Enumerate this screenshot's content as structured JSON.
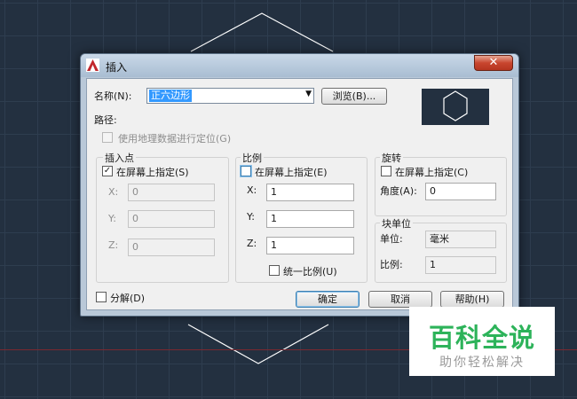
{
  "dialog": {
    "title": "插入",
    "close_glyph": "✕",
    "name_label": "名称(N):",
    "name_value": "正六边形",
    "browse_label": "浏览(B)...",
    "path_label": "路径:",
    "geo_label": "使用地理数据进行定位(G)",
    "insertion": {
      "title": "插入点",
      "specify_label": "在屏幕上指定(S)",
      "specify_checked": true,
      "x_label": "X:",
      "x_value": "0",
      "y_label": "Y:",
      "y_value": "0",
      "z_label": "Z:",
      "z_value": "0"
    },
    "scale": {
      "title": "比例",
      "specify_label": "在屏幕上指定(E)",
      "specify_checked": false,
      "x_label": "X:",
      "x_value": "1",
      "y_label": "Y:",
      "y_value": "1",
      "z_label": "Z:",
      "z_value": "1",
      "uniform_label": "统一比例(U)"
    },
    "rotation": {
      "title": "旋转",
      "specify_label": "在屏幕上指定(C)",
      "specify_checked": false,
      "angle_label": "角度(A):",
      "angle_value": "0"
    },
    "block_unit": {
      "title": "块单位",
      "unit_label": "单位:",
      "unit_value": "毫米",
      "factor_label": "比例:",
      "factor_value": "1"
    },
    "explode_label": "分解(D)",
    "ok_label": "确定",
    "cancel_label": "取消",
    "help_label": "帮助(H)"
  },
  "watermark": {
    "main": "百科全说",
    "sub": "助你轻松解决"
  },
  "colors": {
    "canvas_bg": "#233040",
    "selection": "#3399ff",
    "watermark_green": "#2db35a"
  }
}
